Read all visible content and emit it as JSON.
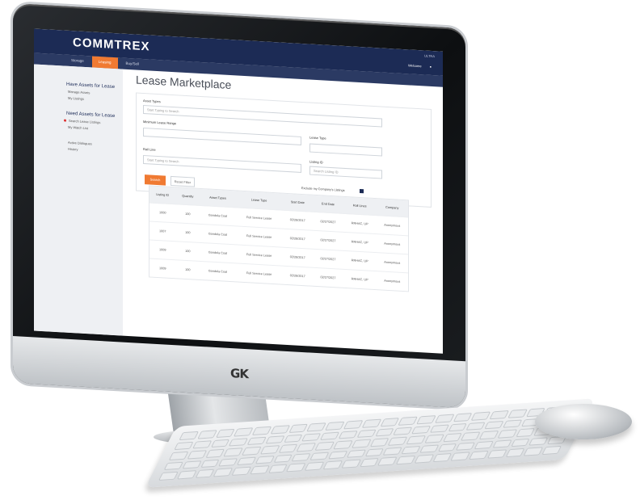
{
  "app": {
    "brand": "COMMTREX",
    "header_right": "ULTRA",
    "header_user": "Welcome",
    "header_user_icon": "user-icon"
  },
  "tabs": [
    {
      "label": "Storage"
    },
    {
      "label": "Leasing",
      "active": true
    },
    {
      "label": "Buy/Sell"
    }
  ],
  "sidebar": {
    "section1_title": "Have Assets for Lease",
    "section1_items": [
      "Manage Assets",
      "My Listings"
    ],
    "section2_title": "Need Assets for Lease",
    "section2_items": [
      "Search Lease Listings",
      "My Watch List"
    ],
    "section3_items": [
      "Active Dialogues",
      "History"
    ]
  },
  "main": {
    "page_title": "Lease Marketplace",
    "asset_types_label": "Asset Types",
    "asset_types_placeholder": "Start Typing to Search",
    "min_lease_label": "Minimum Lease Range",
    "lease_type_label": "Lease Type",
    "fleet_label": "Rail Line",
    "fleet_placeholder": "Start Typing to Search",
    "listing_label": "Listing ID",
    "listing_placeholder": "Search Listing ID",
    "search_button": "Search",
    "reset_button": "Reset Filter",
    "checkbox_label": "Exclude my Company's Listings"
  },
  "table": {
    "headers": [
      "Listing ID",
      "Quantity",
      "Asset Types",
      "Lease Type",
      "Start Date",
      "End Date",
      "Rail Lines",
      "Company"
    ],
    "rows": [
      [
        "1000",
        "100",
        "Gondola Coal",
        "Full Service Lease",
        "02/28/2017",
        "02/27/2027",
        "RRHAC, UP",
        "Anonymous"
      ],
      [
        "1007",
        "100",
        "Gondola Coal",
        "Full Service Lease",
        "02/28/2017",
        "02/27/2027",
        "RRHAC, UP",
        "Anonymous"
      ],
      [
        "1009",
        "100",
        "Gondola Coal",
        "Full Service Lease",
        "02/28/2017",
        "02/27/2027",
        "RRHAC, UP",
        "Anonymous"
      ],
      [
        "1009",
        "100",
        "Gondola Coal",
        "Full Service Lease",
        "02/28/2017",
        "02/27/2027",
        "RRHAC, UP",
        "Anonymous"
      ]
    ]
  },
  "hardware": {
    "monitor_logo": "GK"
  }
}
